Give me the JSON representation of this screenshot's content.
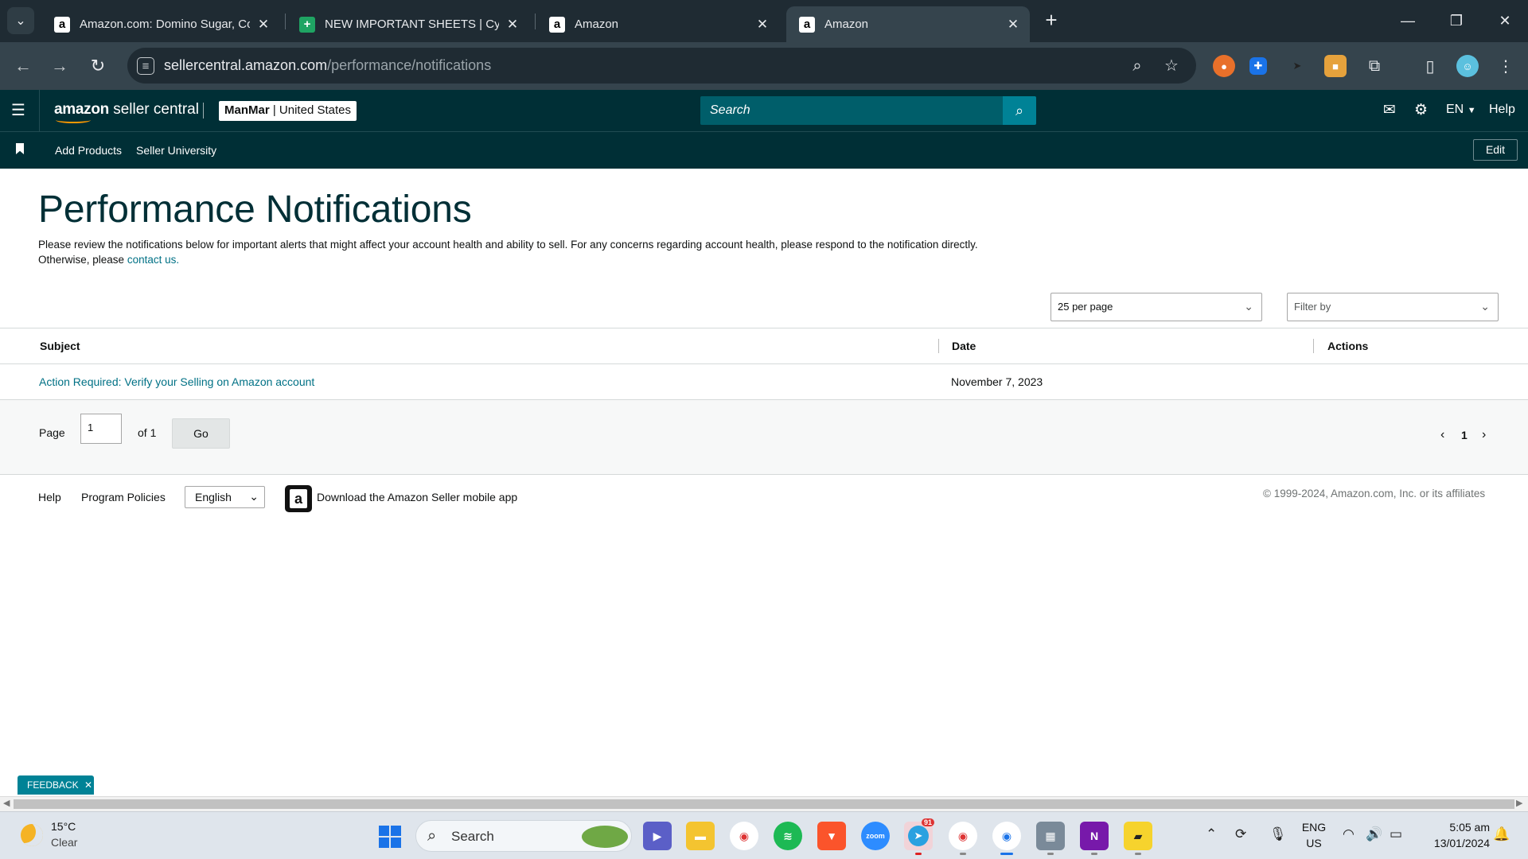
{
  "browser": {
    "tabs": [
      {
        "title": "Amazon.com: Domino Sugar, Conf",
        "favicon": "amazon-icon"
      },
      {
        "title": "NEW IMPORTANT SHEETS | Cyril -",
        "favicon": "sheets-icon"
      },
      {
        "title": "Amazon",
        "favicon": "amazon-icon"
      },
      {
        "title": "Amazon",
        "favicon": "amazon-icon",
        "active": true
      }
    ],
    "url_host": "sellercentral.amazon.com",
    "url_path": "/performance/notifications"
  },
  "header": {
    "logo_amazon": "amazon",
    "logo_product": "seller central",
    "account_store": "ManMar",
    "account_region": "| United States",
    "search_placeholder": "Search",
    "language": "EN",
    "help": "Help"
  },
  "nav": {
    "links": [
      "Add Products",
      "Seller University"
    ],
    "edit": "Edit"
  },
  "page": {
    "title": "Performance Notifications",
    "intro_line1": "Please review the notifications below for important alerts that might affect your account health and ability to sell. For any concerns regarding account health, please respond to the notification directly.",
    "intro_line2_prefix": "Otherwise, please ",
    "intro_link": "contact us."
  },
  "controls": {
    "per_page": "25 per page",
    "filter_placeholder": "Filter by"
  },
  "table": {
    "columns": [
      "Subject",
      "Date",
      "Actions"
    ],
    "rows": [
      {
        "subject": "Action Required: Verify your Selling on Amazon account",
        "date": "November 7, 2023",
        "actions": ""
      }
    ]
  },
  "pagination": {
    "page_label": "Page",
    "current_page": "1",
    "of_label": "of 1",
    "go": "Go",
    "page_number": "1"
  },
  "footer": {
    "help": "Help",
    "program_policies": "Program Policies",
    "language": "English",
    "app_download": "Download the Amazon Seller mobile app",
    "copyright": "© 1999-2024, Amazon.com, Inc. or its affiliates"
  },
  "feedback": "FEEDBACK",
  "taskbar": {
    "temperature": "15°C",
    "weather": "Clear",
    "search": "Search",
    "telegram_badge": "91",
    "lang_top": "ENG",
    "lang_bottom": "US",
    "time": "5:05 am",
    "date": "13/01/2024"
  },
  "colors": {
    "header_bg": "#002f36",
    "link": "#007185",
    "search_btn": "#008296",
    "browser_bg": "#1f2b33"
  }
}
